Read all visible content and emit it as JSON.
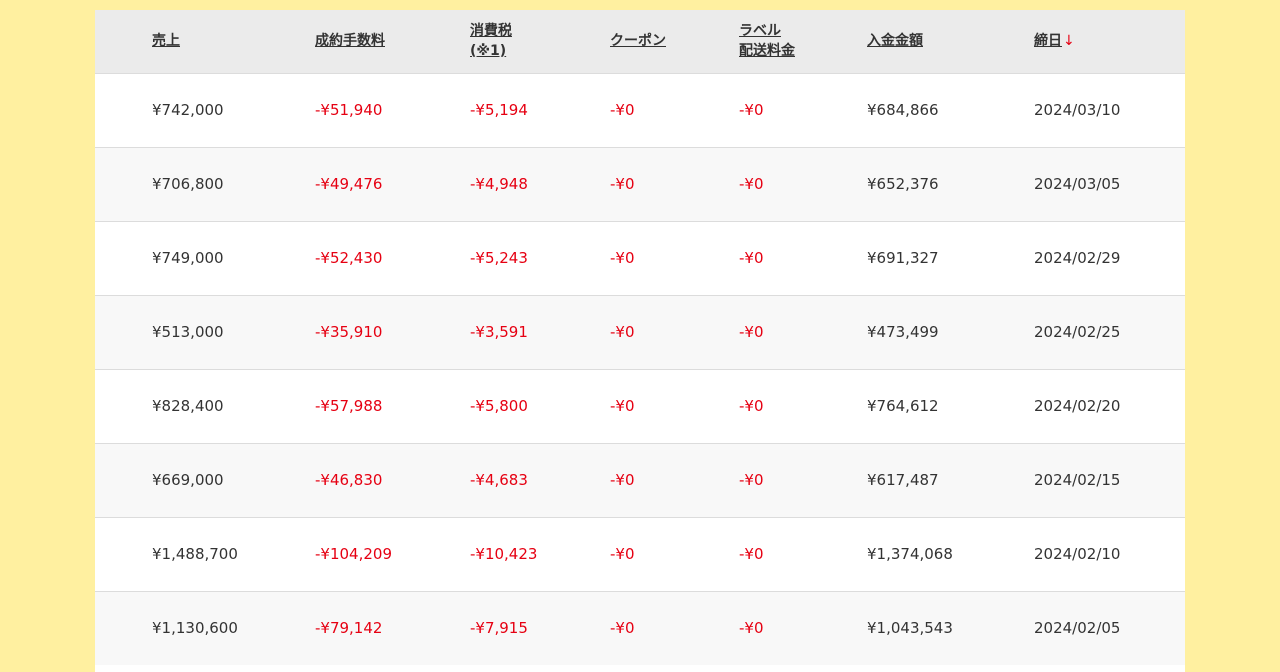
{
  "table": {
    "headers": {
      "sales": "売上",
      "fee": "成約手数料",
      "tax_line1": "消費税",
      "tax_line2": "(※1)",
      "coupon": "クーポン",
      "label_line1": "ラベル",
      "label_line2": "配送料金",
      "deposit": "入金金額",
      "closing": "締日",
      "sort_arrow": "↓"
    },
    "rows": [
      {
        "sales": "¥742,000",
        "fee": "-¥51,940",
        "tax": "-¥5,194",
        "coupon": "-¥0",
        "label": "-¥0",
        "deposit": "¥684,866",
        "closing": "2024/03/10"
      },
      {
        "sales": "¥706,800",
        "fee": "-¥49,476",
        "tax": "-¥4,948",
        "coupon": "-¥0",
        "label": "-¥0",
        "deposit": "¥652,376",
        "closing": "2024/03/05"
      },
      {
        "sales": "¥749,000",
        "fee": "-¥52,430",
        "tax": "-¥5,243",
        "coupon": "-¥0",
        "label": "-¥0",
        "deposit": "¥691,327",
        "closing": "2024/02/29"
      },
      {
        "sales": "¥513,000",
        "fee": "-¥35,910",
        "tax": "-¥3,591",
        "coupon": "-¥0",
        "label": "-¥0",
        "deposit": "¥473,499",
        "closing": "2024/02/25"
      },
      {
        "sales": "¥828,400",
        "fee": "-¥57,988",
        "tax": "-¥5,800",
        "coupon": "-¥0",
        "label": "-¥0",
        "deposit": "¥764,612",
        "closing": "2024/02/20"
      },
      {
        "sales": "¥669,000",
        "fee": "-¥46,830",
        "tax": "-¥4,683",
        "coupon": "-¥0",
        "label": "-¥0",
        "deposit": "¥617,487",
        "closing": "2024/02/15"
      },
      {
        "sales": "¥1,488,700",
        "fee": "-¥104,209",
        "tax": "-¥10,423",
        "coupon": "-¥0",
        "label": "-¥0",
        "deposit": "¥1,374,068",
        "closing": "2024/02/10"
      },
      {
        "sales": "¥1,130,600",
        "fee": "-¥79,142",
        "tax": "-¥7,915",
        "coupon": "-¥0",
        "label": "-¥0",
        "deposit": "¥1,043,543",
        "closing": "2024/02/05"
      }
    ]
  },
  "colors": {
    "page_background": "#fff0a0",
    "header_background": "#ebebeb",
    "negative_text": "#e60012",
    "text": "#333333"
  }
}
